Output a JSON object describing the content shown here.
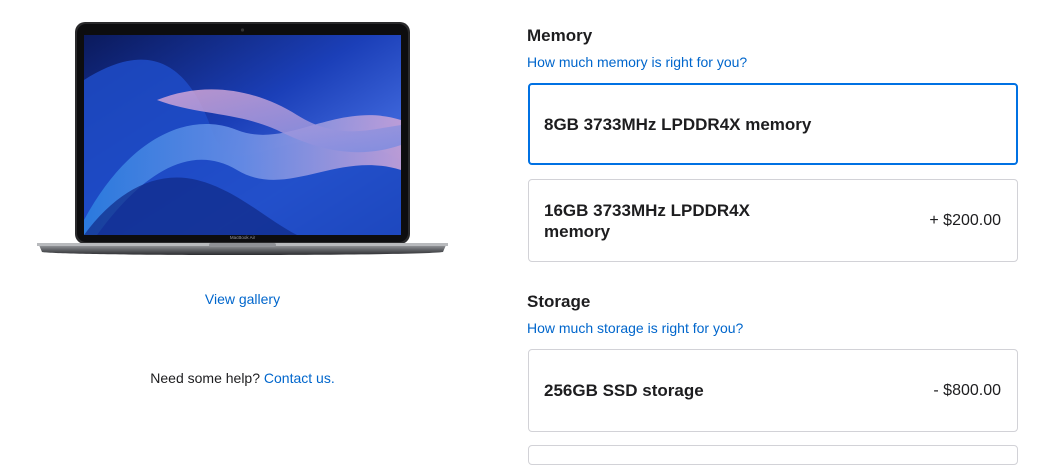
{
  "left": {
    "product_image_alt": "MacBook Air",
    "laptop_badge": "MacBook Air",
    "view_gallery": "View gallery",
    "help_text": "Need some help?",
    "help_link": "Contact us."
  },
  "memory": {
    "title": "Memory",
    "help_link": "How much memory is right for you?",
    "options": [
      {
        "label": "8GB 3733MHz LPDDR4X memory",
        "price": "",
        "selected": true
      },
      {
        "label": "16GB 3733MHz LPDDR4X memory",
        "price": "+ $200.00",
        "selected": false
      }
    ]
  },
  "storage": {
    "title": "Storage",
    "help_link": "How much storage is right for you?",
    "options": [
      {
        "label": "256GB SSD storage",
        "price": "- $800.00",
        "selected": false
      }
    ]
  },
  "colors": {
    "selected_border": "#0071e3",
    "link": "#0066cc",
    "border": "#d2d2d7",
    "text": "#1d1d1f"
  }
}
